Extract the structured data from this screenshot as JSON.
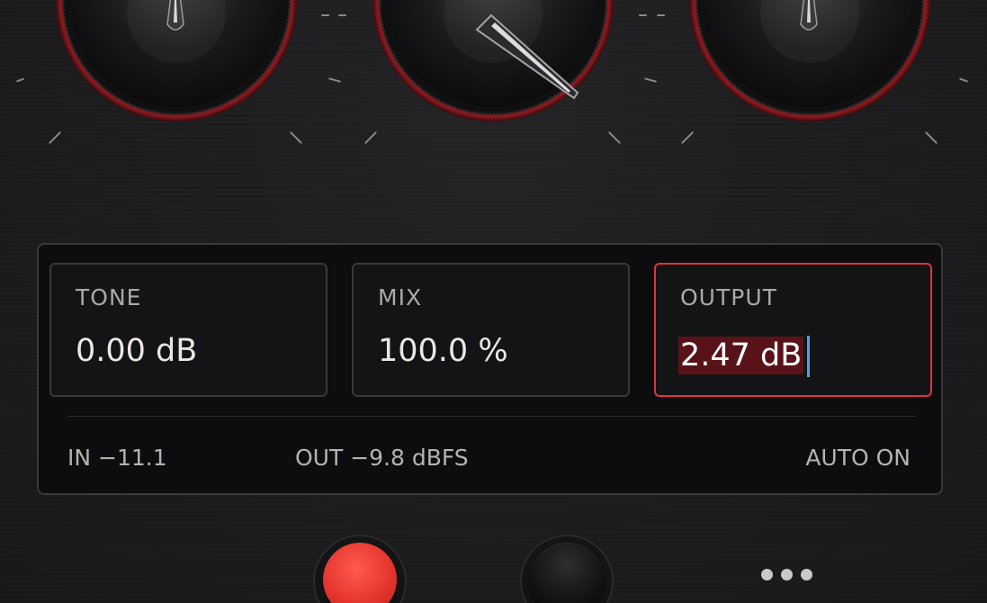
{
  "knobs": [
    {
      "name": "tone",
      "pointer_angle_deg": 0
    },
    {
      "name": "mix",
      "pointer_angle_deg": 135
    },
    {
      "name": "output",
      "pointer_angle_deg": 0
    }
  ],
  "params": {
    "tone": {
      "label": "TONE",
      "value": "0.00 dB"
    },
    "mix": {
      "label": "MIX",
      "value": "100.0 %"
    },
    "output": {
      "label": "OUTPUT",
      "value": "2.47 dB"
    }
  },
  "meters": {
    "in": "IN −11.1",
    "out": "OUT −9.8 dBFS",
    "auto": "AUTO ON"
  },
  "buttons": {
    "record": {
      "color": "#e5352e"
    },
    "secondary": {
      "color": "#111112"
    },
    "more": {
      "icon": "more-horizontal-icon"
    }
  },
  "colors": {
    "accent": "#e2333b",
    "edit_highlight": "#5a1219",
    "caret": "#4aa3e8",
    "knob_ring": "#8e1a1f"
  }
}
